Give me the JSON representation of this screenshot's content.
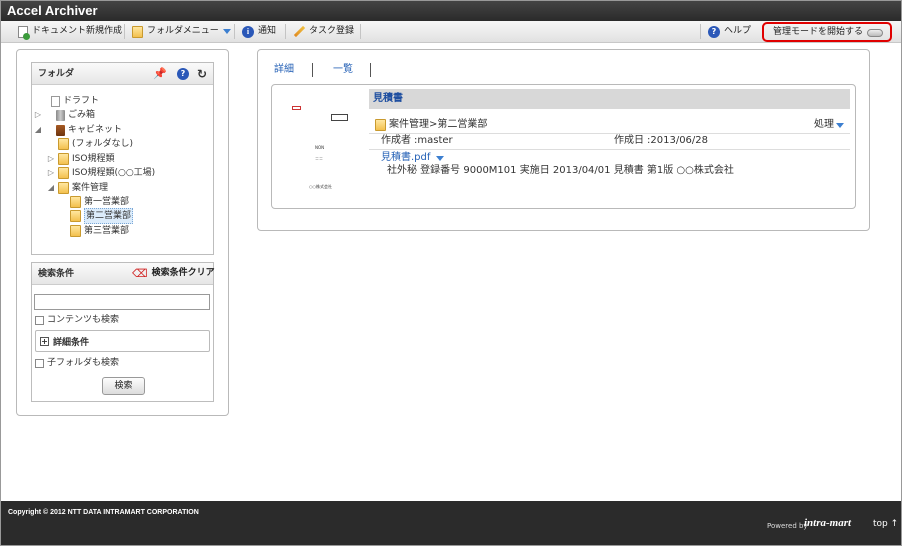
{
  "app": {
    "title": "Accel Archiver"
  },
  "toolbar": {
    "new_document": "ドキュメント新規作成",
    "folder_menu": "フォルダメニュー",
    "notice": "通知",
    "task_register": "タスク登録",
    "help": "ヘルプ",
    "admin_mode": "管理モードを開始する"
  },
  "folder_panel": {
    "title": "フォルダ",
    "tree": [
      {
        "label": "ドラフト",
        "icon": "draft-icon"
      },
      {
        "label": "ごみ箱",
        "icon": "trash-icon"
      },
      {
        "label": "キャビネット",
        "icon": "cabinet-icon"
      },
      {
        "label": "(フォルダなし)",
        "icon": "folder-icon"
      },
      {
        "label": "ISO規程類",
        "icon": "folder-icon"
      },
      {
        "label": "ISO規程類(○○工場)",
        "icon": "folder-icon"
      },
      {
        "label": "案件管理",
        "icon": "folder-icon"
      },
      {
        "label": "第一営業部",
        "icon": "folder-icon"
      },
      {
        "label": "第二営業部",
        "icon": "folder-icon",
        "selected": true
      },
      {
        "label": "第三営業部",
        "icon": "folder-icon"
      }
    ]
  },
  "search_panel": {
    "title": "検索条件",
    "clear": "検索条件クリア",
    "query_value": "",
    "content_search": "コンテンツも検索",
    "detail_conditions": "詳細条件",
    "subfolder_search": "子フォルダも検索",
    "search_button": "検索"
  },
  "main": {
    "tabs": [
      "詳細",
      "一覧"
    ],
    "document": {
      "title": "見積書",
      "path": "案件管理>第二営業部",
      "action": "処理",
      "author_label": "作成者",
      "author": ":master",
      "created_label": "作成日",
      "created": ":2013/06/28",
      "file_name": "見積書.pdf",
      "description": "社外秘 登録番号 9000M101 実施日 2013/04/01 見積書 第1版 ○○株式会社"
    },
    "thumbnail": {
      "heading": "NON",
      "sub": "＝＝",
      "company": "○○株式会社"
    }
  },
  "footer": {
    "copyright": "Copyright © 2012 NTT DATA INTRAMART CORPORATION",
    "powered_by": "Powered by",
    "brand": "intra-mart",
    "top": "top ↑"
  }
}
